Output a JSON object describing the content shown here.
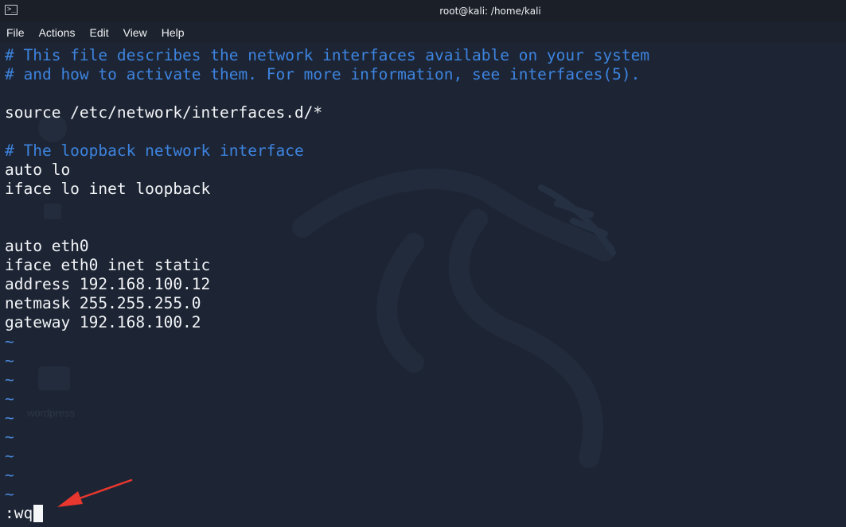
{
  "window": {
    "title": "root@kali: /home/kali",
    "icon": "terminal-icon",
    "icon_glyph": ">_"
  },
  "menu": {
    "items": [
      {
        "label": "File"
      },
      {
        "label": "Actions"
      },
      {
        "label": "Edit"
      },
      {
        "label": "View"
      },
      {
        "label": "Help"
      }
    ]
  },
  "editor": {
    "lines": [
      {
        "text": "# This file describes the network interfaces available on your system",
        "kind": "comment"
      },
      {
        "text": "# and how to activate them. For more information, see interfaces(5).",
        "kind": "comment"
      },
      {
        "text": "",
        "kind": "text"
      },
      {
        "text": "source /etc/network/interfaces.d/*",
        "kind": "text"
      },
      {
        "text": "",
        "kind": "text"
      },
      {
        "text": "# The loopback network interface",
        "kind": "comment"
      },
      {
        "text": "auto lo",
        "kind": "text"
      },
      {
        "text": "iface lo inet loopback",
        "kind": "text"
      },
      {
        "text": "",
        "kind": "text"
      },
      {
        "text": "",
        "kind": "text"
      },
      {
        "text": "auto eth0",
        "kind": "text"
      },
      {
        "text": "iface eth0 inet static",
        "kind": "text"
      },
      {
        "text": "address 192.168.100.12",
        "kind": "text"
      },
      {
        "text": "netmask 255.255.255.0",
        "kind": "text"
      },
      {
        "text": "gateway 192.168.100.2",
        "kind": "text"
      },
      {
        "text": "~",
        "kind": "tilde"
      },
      {
        "text": "~",
        "kind": "tilde"
      },
      {
        "text": "~",
        "kind": "tilde"
      },
      {
        "text": "~",
        "kind": "tilde"
      },
      {
        "text": "~",
        "kind": "tilde"
      },
      {
        "text": "~",
        "kind": "tilde"
      },
      {
        "text": "~",
        "kind": "tilde"
      },
      {
        "text": "~",
        "kind": "tilde"
      },
      {
        "text": "~",
        "kind": "tilde"
      }
    ],
    "command": ":wq"
  },
  "background": {
    "ghost_label": "wordpress"
  },
  "colors": {
    "comment": "#3d84e0",
    "tilde": "#4a86d8",
    "text": "#f2f4f7",
    "background": "#1d2534",
    "annotation_arrow": "#e8372f"
  }
}
